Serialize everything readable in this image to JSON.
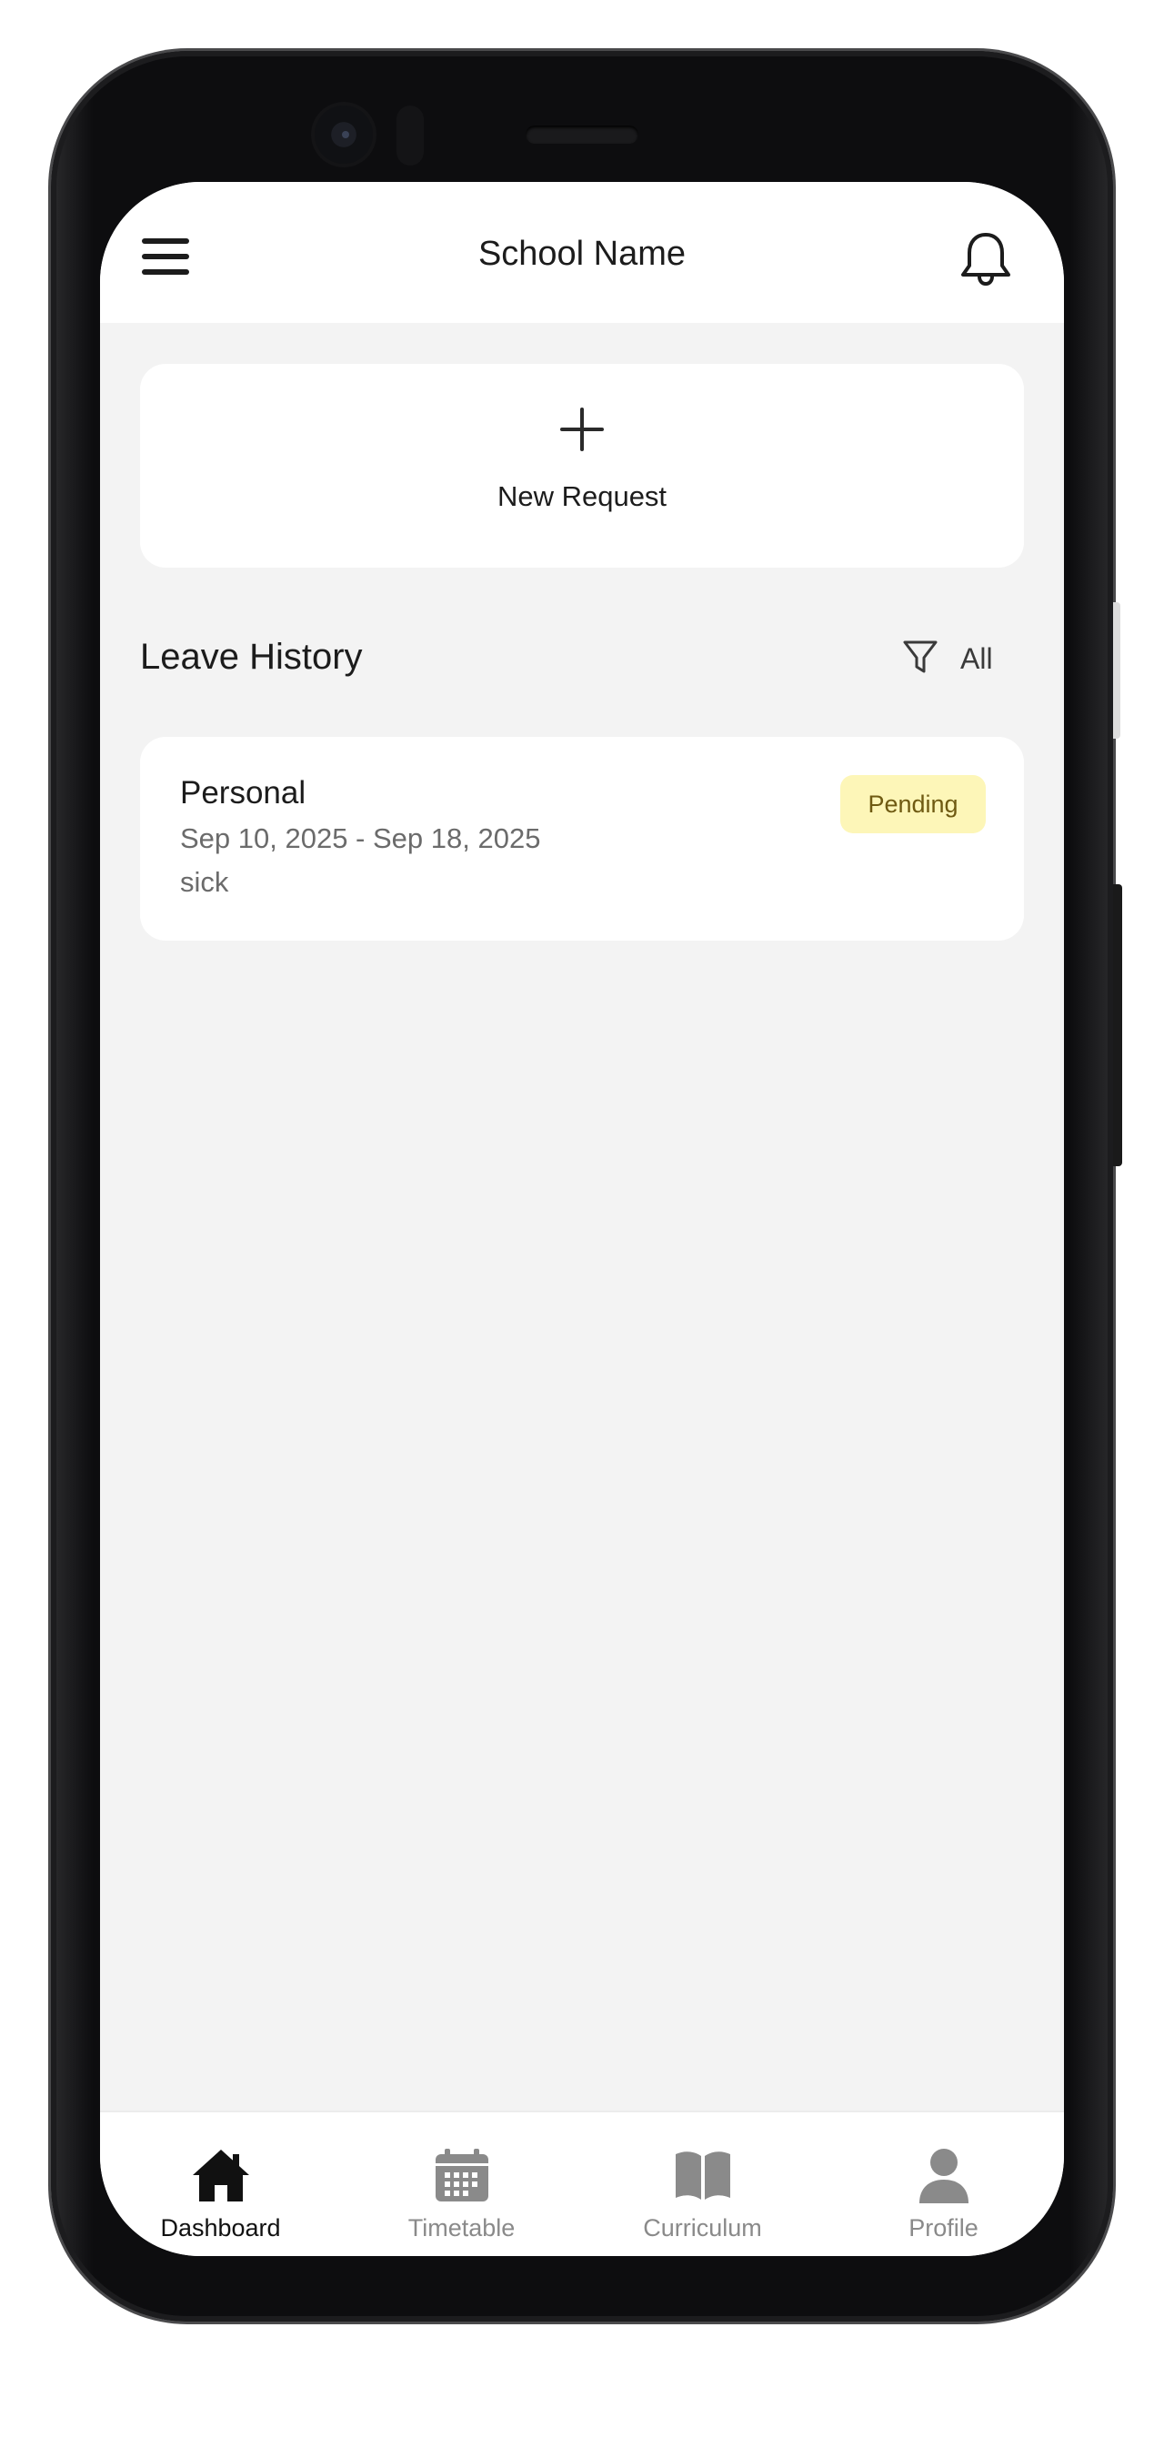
{
  "appbar": {
    "title": "School Name",
    "menu_icon": "hamburger-menu-icon",
    "notification_icon": "bell-icon"
  },
  "new_request": {
    "icon": "plus-icon",
    "label": "New Request"
  },
  "leave_history": {
    "title": "Leave History",
    "filter_icon": "filter-icon",
    "filter_value": "All",
    "items": [
      {
        "type": "Personal",
        "dates": "Sep 10, 2025 - Sep 18, 2025",
        "reason": "sick",
        "status": "Pending",
        "status_bg": "#fdf6b8",
        "status_color": "#6f5a12"
      }
    ]
  },
  "bottom_nav": {
    "items": [
      {
        "label": "Dashboard",
        "icon": "home-icon",
        "active": true
      },
      {
        "label": "Timetable",
        "icon": "calendar-icon",
        "active": false
      },
      {
        "label": "Curriculum",
        "icon": "book-icon",
        "active": false
      },
      {
        "label": "Profile",
        "icon": "person-icon",
        "active": false
      }
    ],
    "active_color": "#111111",
    "inactive_color": "#8a8a8a"
  }
}
